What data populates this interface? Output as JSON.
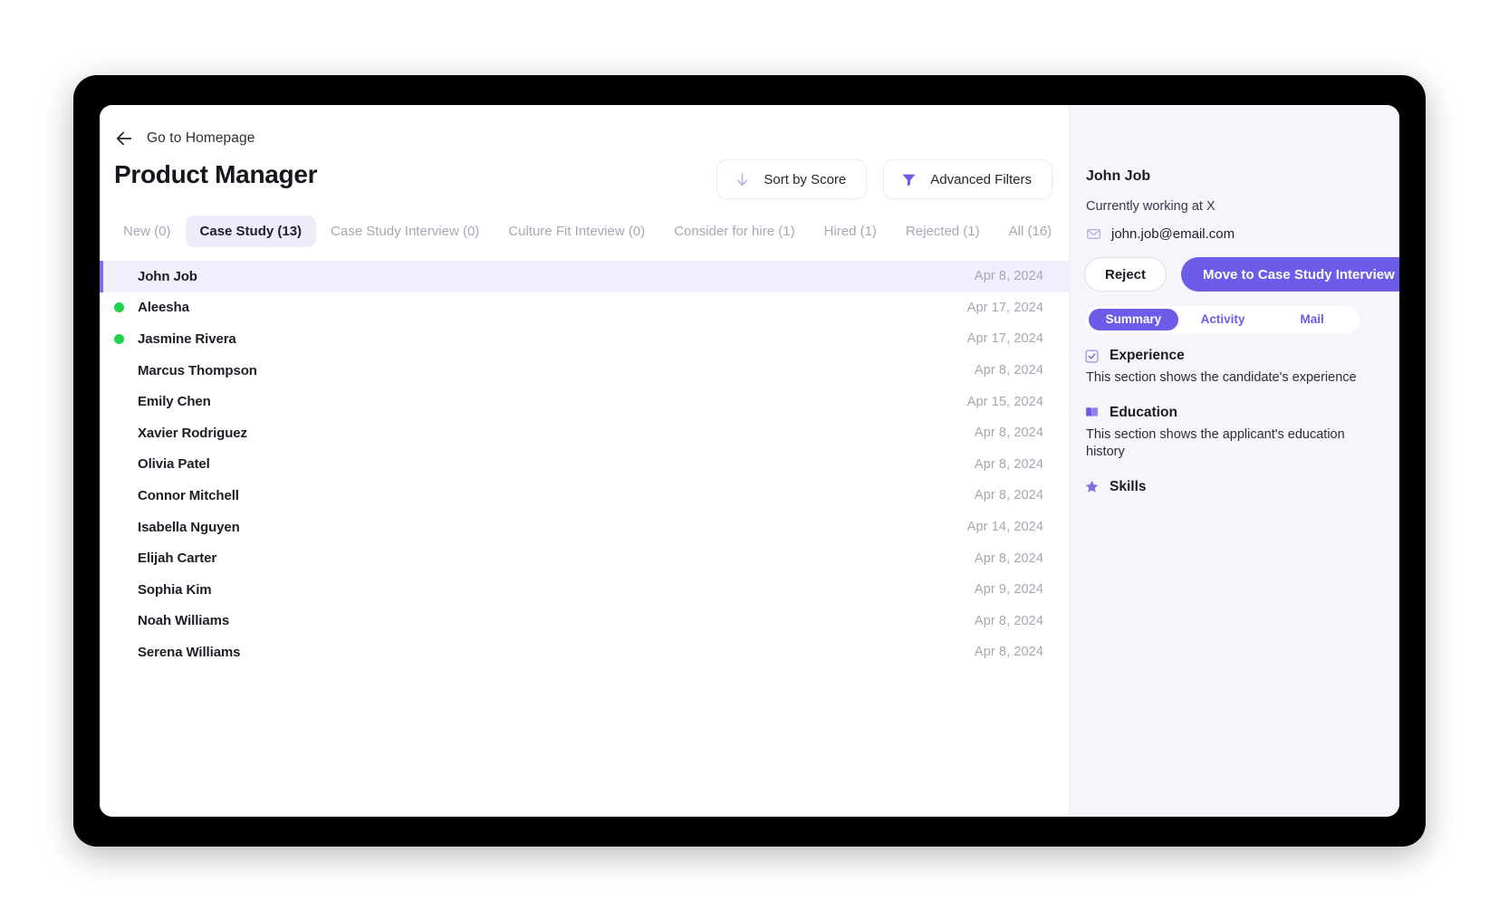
{
  "window": {
    "back_link": "Go to Homepage",
    "title": "Product Manager"
  },
  "toolbar": {
    "sort_label": "Sort by Score",
    "sort_icon": "arrow-down-icon",
    "filters_label": "Advanced Filters",
    "filters_icon": "funnel-icon"
  },
  "tabs": [
    {
      "label": "New (0)",
      "active": false
    },
    {
      "label": "Case Study (13)",
      "active": true
    },
    {
      "label": "Case Study Interview (0)",
      "active": false
    },
    {
      "label": "Culture Fit Inteview (0)",
      "active": false
    },
    {
      "label": "Consider for hire (1)",
      "active": false
    },
    {
      "label": "Hired (1)",
      "active": false
    },
    {
      "label": "Rejected (1)",
      "active": false
    },
    {
      "label": "All (16)",
      "active": false
    }
  ],
  "candidates": [
    {
      "name": "John Job",
      "date": "Apr 8, 2024",
      "selected": true,
      "dot": false
    },
    {
      "name": "Aleesha",
      "date": "Apr 17, 2024",
      "selected": false,
      "dot": true
    },
    {
      "name": "Jasmine Rivera",
      "date": "Apr 17, 2024",
      "selected": false,
      "dot": true
    },
    {
      "name": "Marcus Thompson",
      "date": "Apr 8, 2024",
      "selected": false,
      "dot": false
    },
    {
      "name": "Emily Chen",
      "date": "Apr 15, 2024",
      "selected": false,
      "dot": false
    },
    {
      "name": "Xavier Rodriguez",
      "date": "Apr 8, 2024",
      "selected": false,
      "dot": false
    },
    {
      "name": "Olivia Patel",
      "date": "Apr 8, 2024",
      "selected": false,
      "dot": false
    },
    {
      "name": "Connor Mitchell",
      "date": "Apr 8, 2024",
      "selected": false,
      "dot": false
    },
    {
      "name": "Isabella Nguyen",
      "date": "Apr 14, 2024",
      "selected": false,
      "dot": false
    },
    {
      "name": "Elijah Carter",
      "date": "Apr 8, 2024",
      "selected": false,
      "dot": false
    },
    {
      "name": "Sophia Kim",
      "date": "Apr 9, 2024",
      "selected": false,
      "dot": false
    },
    {
      "name": "Noah Williams",
      "date": "Apr 8, 2024",
      "selected": false,
      "dot": false
    },
    {
      "name": "Serena Williams",
      "date": "Apr 8, 2024",
      "selected": false,
      "dot": false
    }
  ],
  "detail": {
    "name": "John Job",
    "subtitle": "Currently working at X",
    "email": "john.job@email.com",
    "email_icon": "envelope-icon",
    "reject_label": "Reject",
    "move_label": "Move to Case Study Interview",
    "tabs": [
      {
        "label": "Summary",
        "active": true
      },
      {
        "label": "Activity",
        "active": false
      },
      {
        "label": "Mail",
        "active": false
      }
    ],
    "sections": [
      {
        "icon": "checkbox-icon",
        "title": "Experience",
        "body": "This section shows the candidate's experience"
      },
      {
        "icon": "book-icon",
        "title": "Education",
        "body": "This section shows the applicant's education history"
      },
      {
        "icon": "star-icon",
        "title": "Skills",
        "body": ""
      }
    ]
  },
  "colors": {
    "accent": "#6c5ce7",
    "accent_soft": "#eeecfb",
    "status_dot": "#20d24a",
    "panel_bg": "#f6f5fb",
    "muted_text": "#a9a7b4"
  }
}
